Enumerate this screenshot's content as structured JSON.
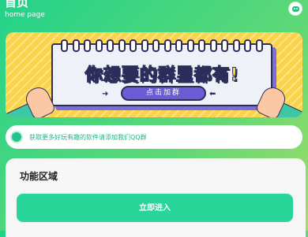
{
  "header": {
    "title": "首页",
    "subtitle": "home page",
    "avatar_icon": "gamepad-icon"
  },
  "banner": {
    "headline": "你想要的群里都有!",
    "button_label": "点击加群"
  },
  "notice": {
    "icon": "circle-dot-icon",
    "text": "获取更多好玩有趣的软件请添加我们QQ群"
  },
  "function_area": {
    "title": "功能区域",
    "enter_button_label": "立即进入"
  },
  "colors": {
    "accent": "#28d69a",
    "header_gradient_start": "#22d28a",
    "header_gradient_end": "#a3dd63"
  }
}
